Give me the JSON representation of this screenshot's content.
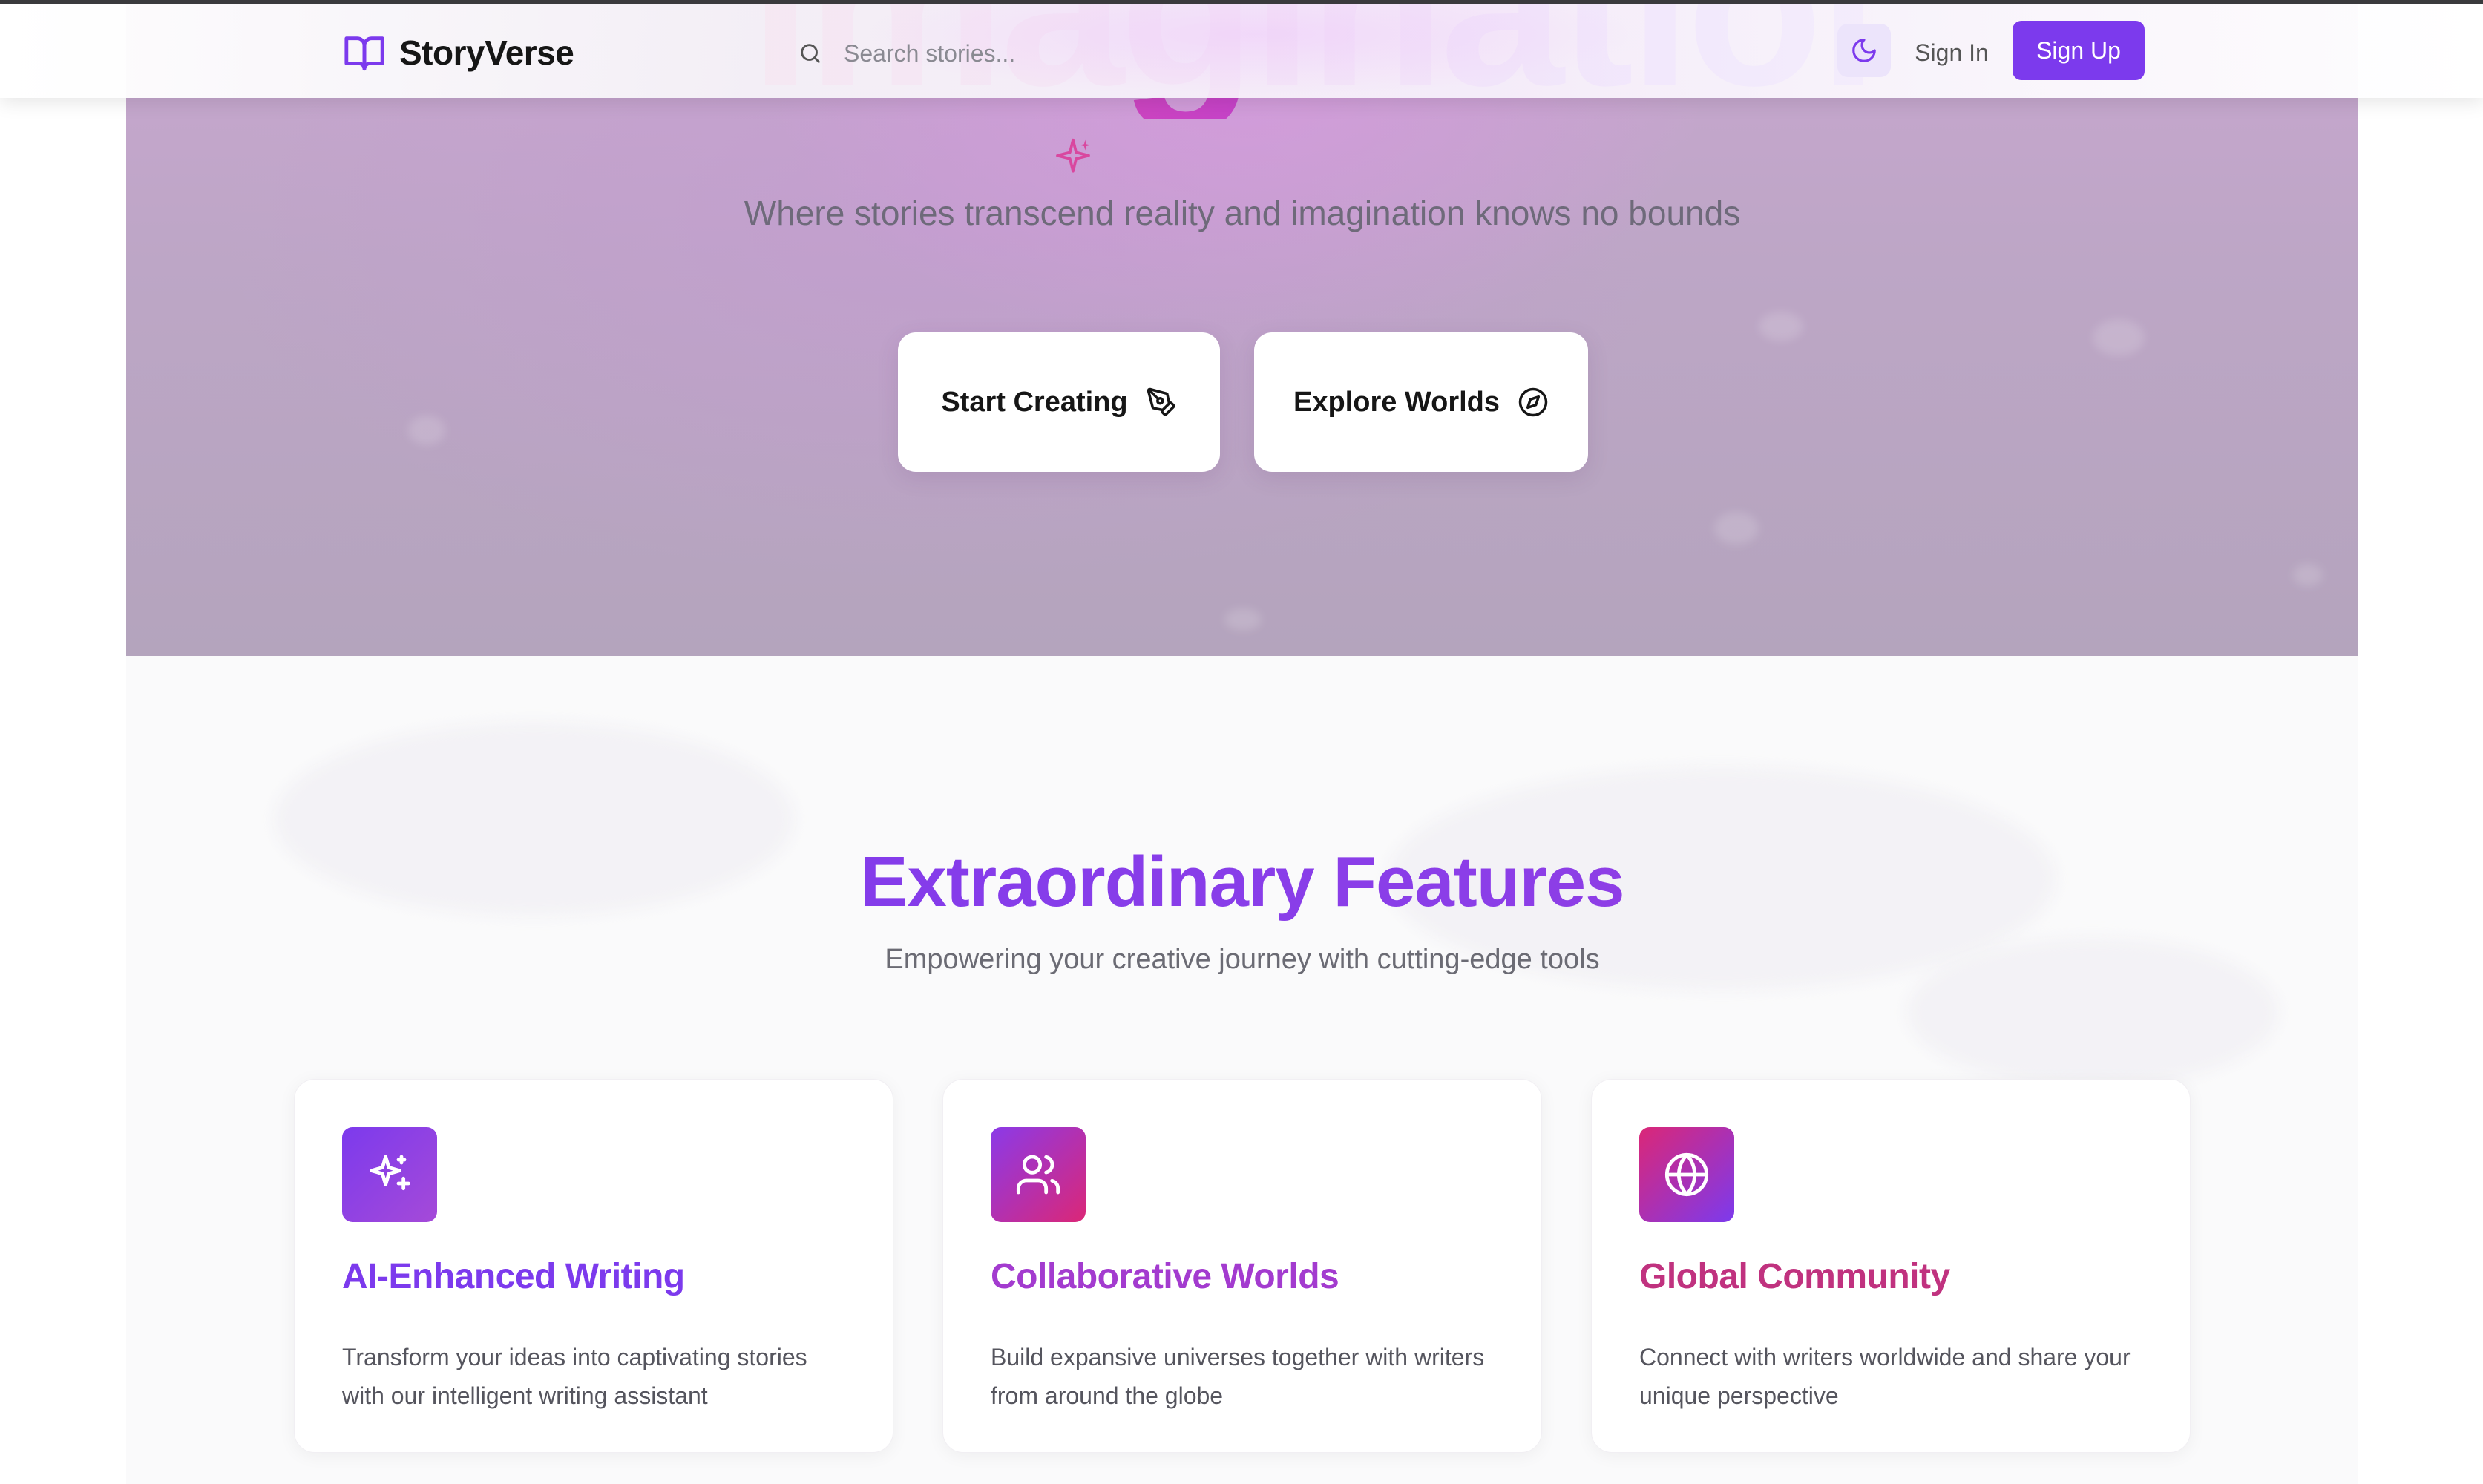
{
  "app": {
    "name": "StoryVerse"
  },
  "navbar": {
    "logo_icon": "open-book-icon",
    "search": {
      "placeholder": "Search stories...",
      "value": "",
      "icon": "search-icon"
    },
    "theme_toggle_icon": "moon-icon",
    "sign_in_label": "Sign In",
    "sign_up_label": "Sign Up"
  },
  "hero": {
    "title_fragment": "imagination",
    "subtitle": "Where stories transcend reality and imagination knows no bounds",
    "buttons": [
      {
        "label": "Start Creating",
        "icon": "pen-tool-icon"
      },
      {
        "label": "Explore Worlds",
        "icon": "compass-icon"
      }
    ]
  },
  "features": {
    "title": "Extraordinary Features",
    "subtitle": "Empowering your creative journey with cutting-edge tools",
    "cards": [
      {
        "icon": "sparkles-icon",
        "title": "AI-Enhanced Writing",
        "description": "Transform your ideas into captivating stories with our intelligent writing assistant"
      },
      {
        "icon": "users-icon",
        "title": "Collaborative Worlds",
        "description": "Build expansive universes together with writers from around the globe"
      },
      {
        "icon": "globe-icon",
        "title": "Global Community",
        "description": "Connect with writers worldwide and share your unique perspective"
      }
    ]
  },
  "colors": {
    "accent": "#7c3aed",
    "accent_pink": "#db2777",
    "text_dark": "#161616",
    "text_muted": "#6b6b74"
  }
}
